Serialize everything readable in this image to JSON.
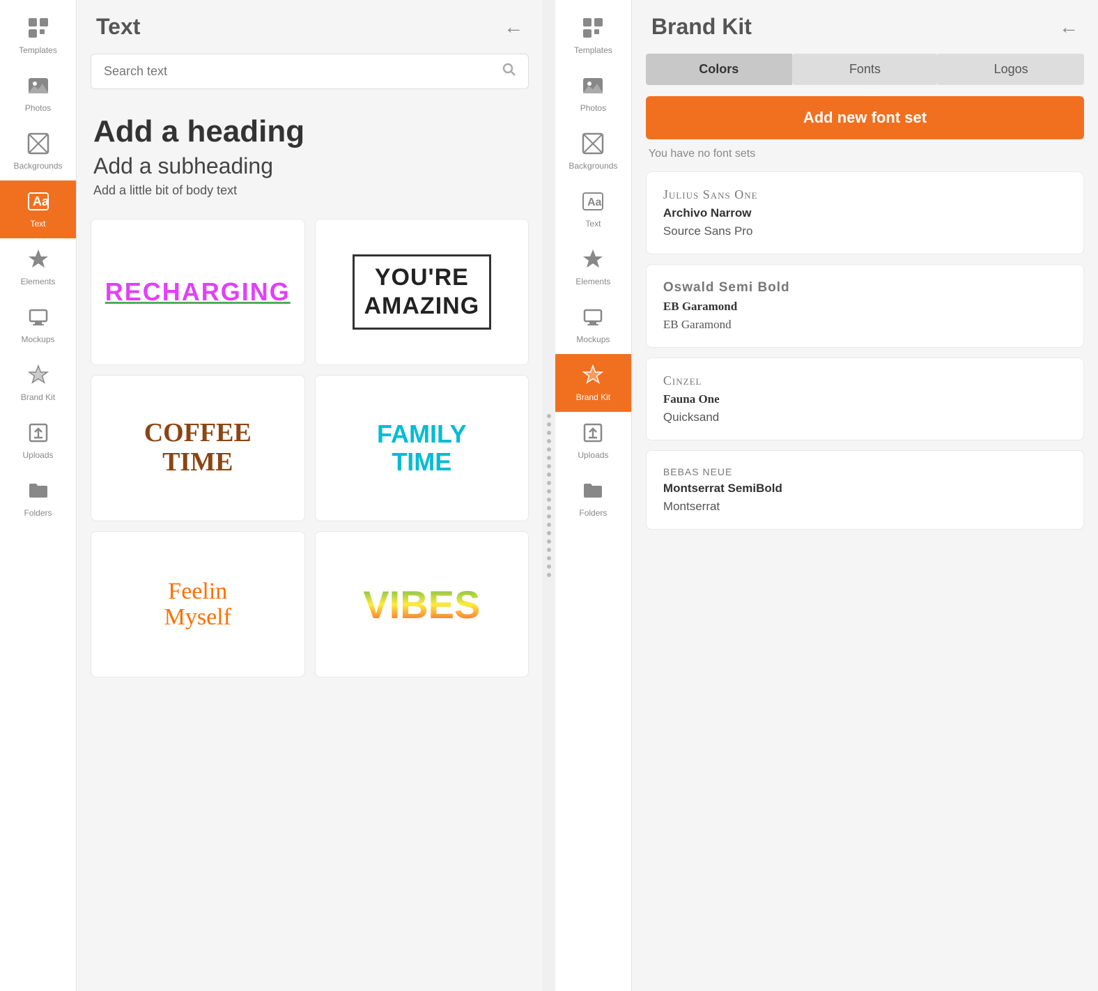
{
  "left_panel": {
    "sidebar": {
      "items": [
        {
          "id": "templates",
          "label": "Templates",
          "icon": "grid"
        },
        {
          "id": "photos",
          "label": "Photos",
          "icon": "photo"
        },
        {
          "id": "backgrounds",
          "label": "Backgrounds",
          "icon": "backgrounds"
        },
        {
          "id": "text",
          "label": "Text",
          "icon": "text",
          "active": true
        },
        {
          "id": "elements",
          "label": "Elements",
          "icon": "elements"
        },
        {
          "id": "mockups",
          "label": "Mockups",
          "icon": "mockups"
        },
        {
          "id": "brand-kit",
          "label": "Brand Kit",
          "icon": "star"
        },
        {
          "id": "uploads",
          "label": "Uploads",
          "icon": "upload"
        },
        {
          "id": "folders",
          "label": "Folders",
          "icon": "folder"
        }
      ]
    },
    "header": {
      "title": "Text",
      "back_label": "←"
    },
    "search": {
      "placeholder": "Search text"
    },
    "text_options": {
      "heading": "Add a heading",
      "subheading": "Add a subheading",
      "body": "Add a little bit of body text"
    },
    "text_cards": [
      {
        "id": "recharging",
        "content": "RECHARGING"
      },
      {
        "id": "amazing",
        "content": "YOU'RE\nAMAZING"
      },
      {
        "id": "coffee",
        "content": "COFFEE\nTIME"
      },
      {
        "id": "family",
        "content": "FAMILY\nTIME"
      },
      {
        "id": "feelin",
        "content": "Feelin\nMyself"
      },
      {
        "id": "vibes",
        "content": "VIBES"
      }
    ]
  },
  "right_panel": {
    "sidebar": {
      "items": [
        {
          "id": "templates",
          "label": "Templates",
          "icon": "grid"
        },
        {
          "id": "photos",
          "label": "Photos",
          "icon": "photo"
        },
        {
          "id": "backgrounds",
          "label": "Backgrounds",
          "icon": "backgrounds"
        },
        {
          "id": "text",
          "label": "Text",
          "icon": "text"
        },
        {
          "id": "elements",
          "label": "Elements",
          "icon": "elements"
        },
        {
          "id": "mockups",
          "label": "Mockups",
          "icon": "mockups"
        },
        {
          "id": "brand-kit",
          "label": "Brand Kit",
          "icon": "star",
          "active": true
        },
        {
          "id": "uploads",
          "label": "Uploads",
          "icon": "upload"
        },
        {
          "id": "folders",
          "label": "Folders",
          "icon": "folder"
        }
      ]
    },
    "header": {
      "title": "Brand Kit",
      "back_label": "←"
    },
    "tabs": [
      {
        "id": "colors",
        "label": "Colors",
        "active": false
      },
      {
        "id": "fonts",
        "label": "Fonts",
        "active": true
      },
      {
        "id": "logos",
        "label": "Logos",
        "active": false
      }
    ],
    "add_font_btn": "Add new font set",
    "no_font_sets_msg": "You have no font sets",
    "font_sets": [
      {
        "id": "set1",
        "fonts": [
          {
            "name": "Julius Sans One",
            "style": "julius"
          },
          {
            "name": "Archivo Narrow",
            "style": "archivo"
          },
          {
            "name": "Source Sans Pro",
            "style": "source"
          }
        ]
      },
      {
        "id": "set2",
        "fonts": [
          {
            "name": "Oswald Semi Bold",
            "style": "oswald"
          },
          {
            "name": "EB Garamond",
            "style": "eb-garamond"
          },
          {
            "name": "EB Garamond",
            "style": "eb-garamond"
          }
        ]
      },
      {
        "id": "set3",
        "fonts": [
          {
            "name": "Cinzel",
            "style": "cinzel"
          },
          {
            "name": "Fauna One",
            "style": "fauna"
          },
          {
            "name": "Quicksand",
            "style": "quicksand"
          }
        ]
      },
      {
        "id": "set4",
        "fonts": [
          {
            "name": "Bebas Neue",
            "style": "bebas"
          },
          {
            "name": "Montserrat SemiBold",
            "style": "montserrat-semi"
          },
          {
            "name": "Montserrat",
            "style": "montserrat"
          }
        ]
      }
    ]
  }
}
